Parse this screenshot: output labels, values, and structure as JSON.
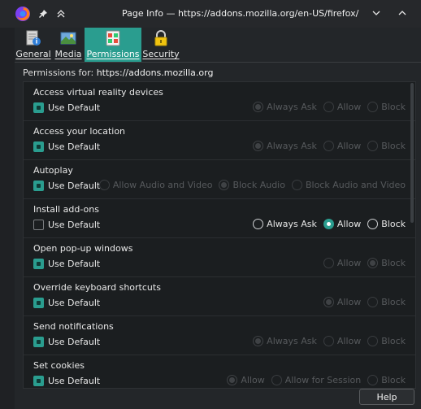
{
  "window": {
    "title": "Page Info — https://addons.mozilla.org/en-US/firefox/"
  },
  "tabs": [
    {
      "label": "General",
      "icon": "general-icon",
      "active": false
    },
    {
      "label": "Media",
      "icon": "media-icon",
      "active": false
    },
    {
      "label": "Permissions",
      "icon": "permissions-icon",
      "active": true
    },
    {
      "label": "Security",
      "icon": "lock-icon",
      "active": false
    }
  ],
  "permissions_for": {
    "label": "Permissions for:",
    "host": "https://addons.mozilla.org"
  },
  "permissions": [
    {
      "name": "Access virtual reality devices",
      "use_default": "Use Default",
      "use_default_checked": true,
      "options": [
        "Always Ask",
        "Allow",
        "Block"
      ],
      "selected": "Always Ask"
    },
    {
      "name": "Access your location",
      "use_default": "Use Default",
      "use_default_checked": true,
      "options": [
        "Always Ask",
        "Allow",
        "Block"
      ],
      "selected": "Always Ask"
    },
    {
      "name": "Autoplay",
      "use_default": "Use Default",
      "use_default_checked": true,
      "options": [
        "Allow Audio and Video",
        "Block Audio",
        "Block Audio and Video"
      ],
      "selected": "Block Audio"
    },
    {
      "name": "Install add-ons",
      "use_default": "Use Default",
      "use_default_checked": false,
      "options": [
        "Always Ask",
        "Allow",
        "Block"
      ],
      "selected": "Allow"
    },
    {
      "name": "Open pop-up windows",
      "use_default": "Use Default",
      "use_default_checked": true,
      "options": [
        "Allow",
        "Block"
      ],
      "selected": "Block"
    },
    {
      "name": "Override keyboard shortcuts",
      "use_default": "Use Default",
      "use_default_checked": true,
      "options": [
        "Allow",
        "Block"
      ],
      "selected": "Allow"
    },
    {
      "name": "Send notifications",
      "use_default": "Use Default",
      "use_default_checked": true,
      "options": [
        "Always Ask",
        "Allow",
        "Block"
      ],
      "selected": "Always Ask"
    },
    {
      "name": "Set cookies",
      "use_default": "Use Default",
      "use_default_checked": true,
      "options": [
        "Allow",
        "Allow for Session",
        "Block"
      ],
      "selected": "Allow"
    }
  ],
  "help_label": "Help",
  "colors": {
    "accent": "#2a9d8f",
    "background": "#232629",
    "panel": "#1b1e20"
  }
}
